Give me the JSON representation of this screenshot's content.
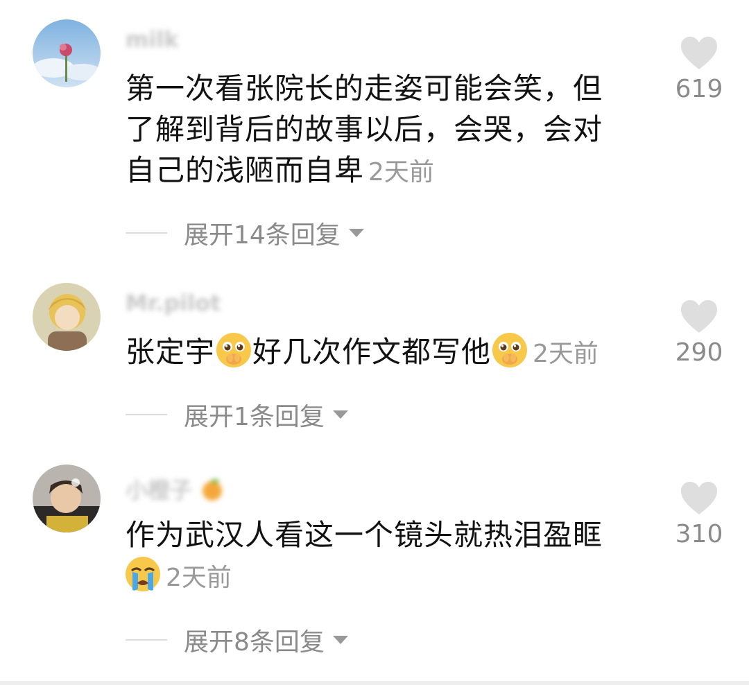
{
  "comments": [
    {
      "username": "milk",
      "text": "第一次看张院长的走姿可能会笑，但了解到背后的故事以后，会哭，会对自己的浅陋而自卑",
      "time": "2天前",
      "likes": "619",
      "expand_label": "展开14条回复"
    },
    {
      "username": "Mr.pilot",
      "text_part1": "张定宇",
      "text_part2": "好几次作文都写他",
      "time": "2天前",
      "likes": "290",
      "expand_label": "展开1条回复"
    },
    {
      "username": "小橙子",
      "text": "作为武汉人看这一个镜头就热泪盈眶",
      "time": "2天前",
      "likes": "310",
      "expand_label": "展开8条回复"
    }
  ],
  "icons": {
    "like": "heart-icon",
    "expand": "caret-down-icon",
    "emoji_1": "pleading-face-emoji",
    "emoji_2": "crying-face-emoji",
    "username_suffix": "orange-emoji"
  },
  "colors": {
    "text": "#121212",
    "secondary": "#8a8a8a",
    "time": "#999999",
    "heart": "#dedede"
  }
}
